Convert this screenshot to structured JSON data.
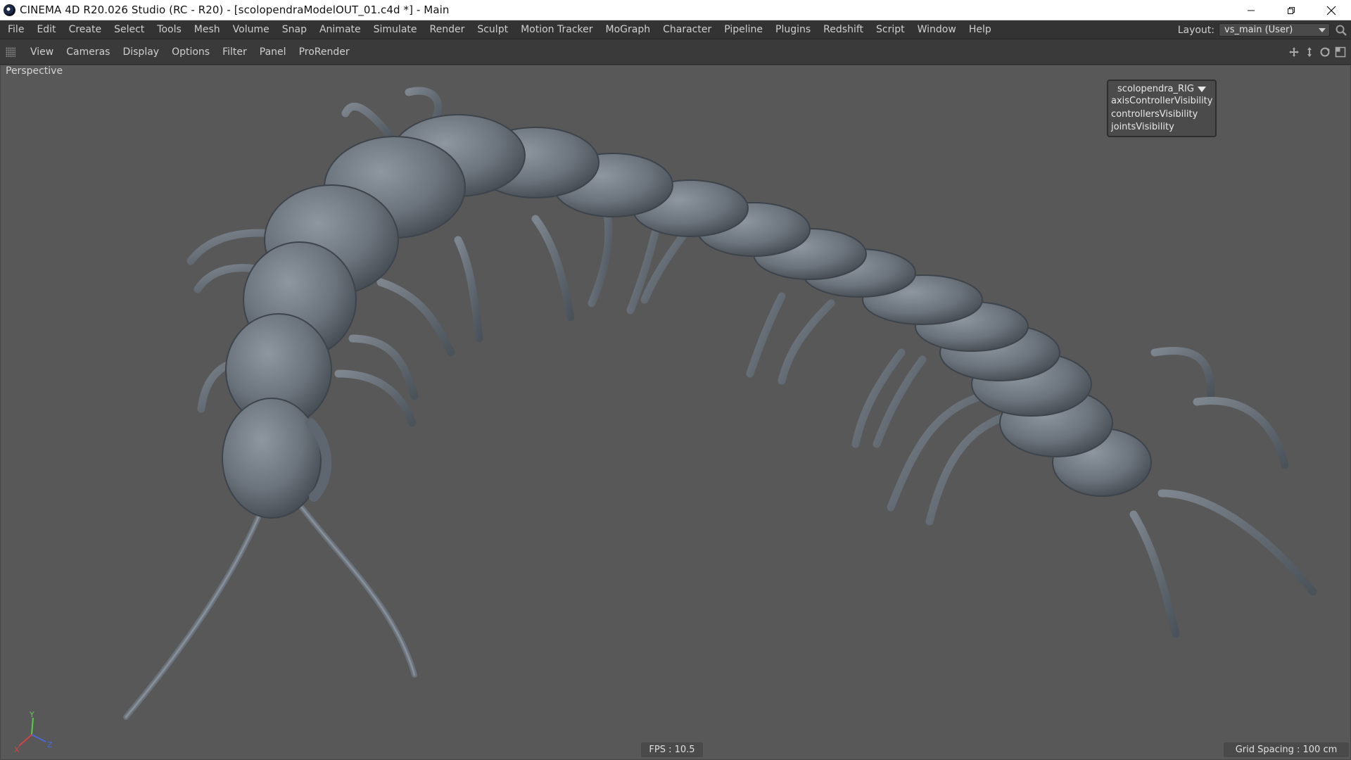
{
  "window": {
    "title": "CINEMA 4D R20.026 Studio (RC - R20) - [scolopendraModelOUT_01.c4d *] - Main",
    "controls": [
      "minimize-icon",
      "restore-icon",
      "close-icon"
    ]
  },
  "menubar": {
    "items": [
      "File",
      "Edit",
      "Create",
      "Select",
      "Tools",
      "Mesh",
      "Volume",
      "Snap",
      "Animate",
      "Simulate",
      "Render",
      "Sculpt",
      "Motion Tracker",
      "MoGraph",
      "Character",
      "Pipeline",
      "Plugins",
      "Redshift",
      "Script",
      "Window",
      "Help"
    ],
    "layout_label": "Layout:",
    "layout_value": "vs_main (User)"
  },
  "viewbar": {
    "items": [
      "View",
      "Cameras",
      "Display",
      "Options",
      "Filter",
      "Panel",
      "ProRender"
    ],
    "icons": [
      "move-view-icon",
      "zoom-view-icon",
      "rotate-view-icon",
      "maximize-view-icon"
    ]
  },
  "viewport": {
    "camera_label": "Perspective",
    "rig_panel": {
      "title": "scolopendra_RIG",
      "params": [
        "axisControllerVisibility",
        "controllersVisibility",
        "jointsVisibility"
      ]
    },
    "axis": {
      "x": "X",
      "y": "Y",
      "z": "Z"
    },
    "fps": "FPS : 10.5",
    "grid_spacing": "Grid Spacing : 100 cm"
  },
  "colors": {
    "viewport_bg": "#585858",
    "model": "#6f7780",
    "menu_bg": "#333333"
  }
}
